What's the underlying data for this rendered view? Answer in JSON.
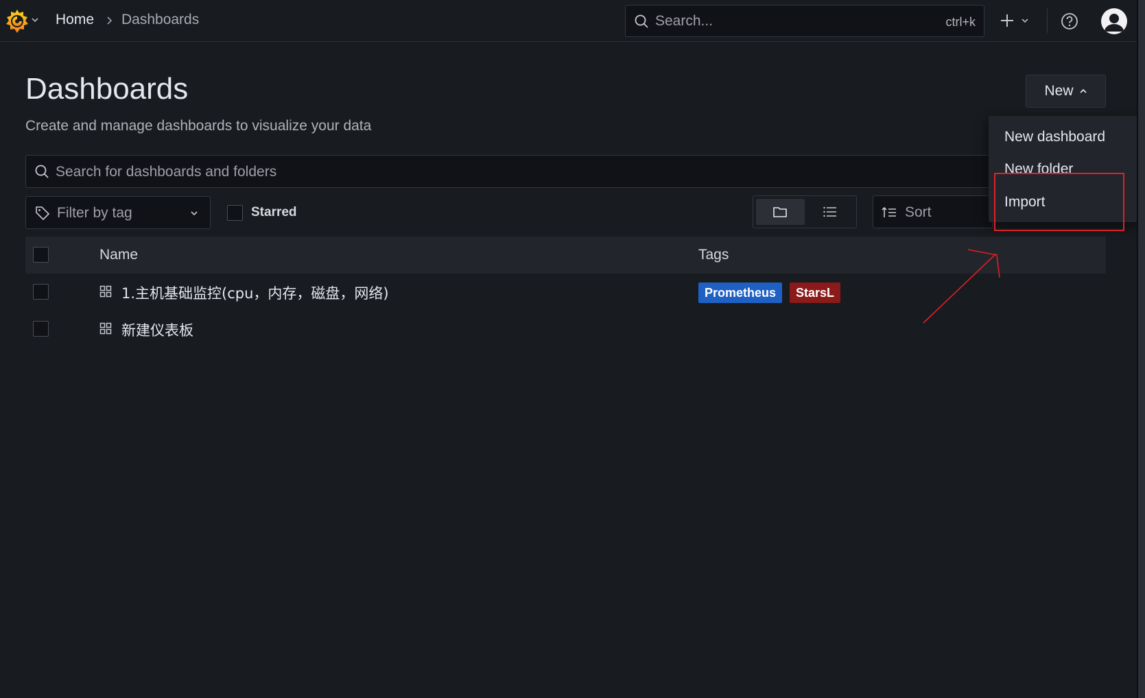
{
  "topbar": {
    "breadcrumb": {
      "home": "Home",
      "current": "Dashboards"
    },
    "search": {
      "placeholder": "Search...",
      "shortcut": "ctrl+k"
    }
  },
  "page": {
    "title": "Dashboards",
    "subtitle": "Create and manage dashboards to visualize your data",
    "new_button": "New"
  },
  "new_menu": {
    "items": [
      "New dashboard",
      "New folder",
      "Import"
    ],
    "highlighted": "Import"
  },
  "search": {
    "placeholder": "Search for dashboards and folders"
  },
  "filters": {
    "tag_placeholder": "Filter by tag",
    "starred_label": "Starred",
    "sort_placeholder": "Sort",
    "view_mode": "folder"
  },
  "table": {
    "columns": {
      "name": "Name",
      "tags": "Tags"
    },
    "rows": [
      {
        "name": "1.主机基础监控(cpu，内存，磁盘，网络)",
        "tags": [
          {
            "label": "Prometheus",
            "color": "#1f60c4"
          },
          {
            "label": "StarsL",
            "color": "#8b1a1a"
          }
        ]
      },
      {
        "name": "新建仪表板",
        "tags": []
      }
    ]
  },
  "colors": {
    "background": "#181b1f",
    "annotation": "#e0202a"
  }
}
